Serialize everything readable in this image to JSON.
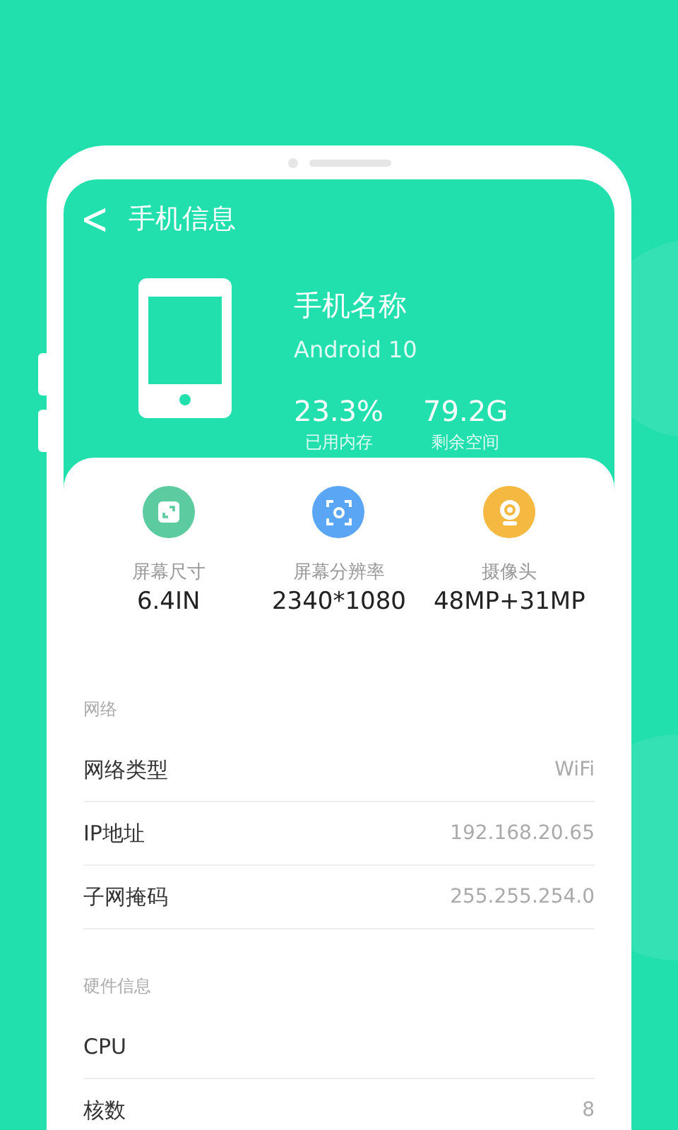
{
  "header": {
    "back": "<",
    "title": "手机信息"
  },
  "device": {
    "name": "手机名称",
    "os": "Android 10",
    "stats": [
      {
        "value": "23.3%",
        "label": "已用内存"
      },
      {
        "value": "79.2G",
        "label": "剩余空间"
      }
    ]
  },
  "specs": [
    {
      "kind": "size",
      "label": "屏幕尺寸",
      "value": "6.4IN",
      "color": "#5ccba0"
    },
    {
      "kind": "resolution",
      "label": "屏幕分辨率",
      "value": "2340*1080",
      "color": "#5aa6f5"
    },
    {
      "kind": "camera",
      "label": "摄像头",
      "value": "48MP+31MP",
      "color": "#f5b942"
    }
  ],
  "sections": [
    {
      "title": "网络",
      "rows": [
        {
          "label": "网络类型",
          "value": "WiFi"
        },
        {
          "label": "IP地址",
          "value": "192.168.20.65"
        },
        {
          "label": "子网掩码",
          "value": "255.255.254.0"
        }
      ]
    },
    {
      "title": "硬件信息",
      "rows": [
        {
          "label": "CPU"
        },
        {
          "label": "核数",
          "value": "8"
        }
      ]
    }
  ]
}
